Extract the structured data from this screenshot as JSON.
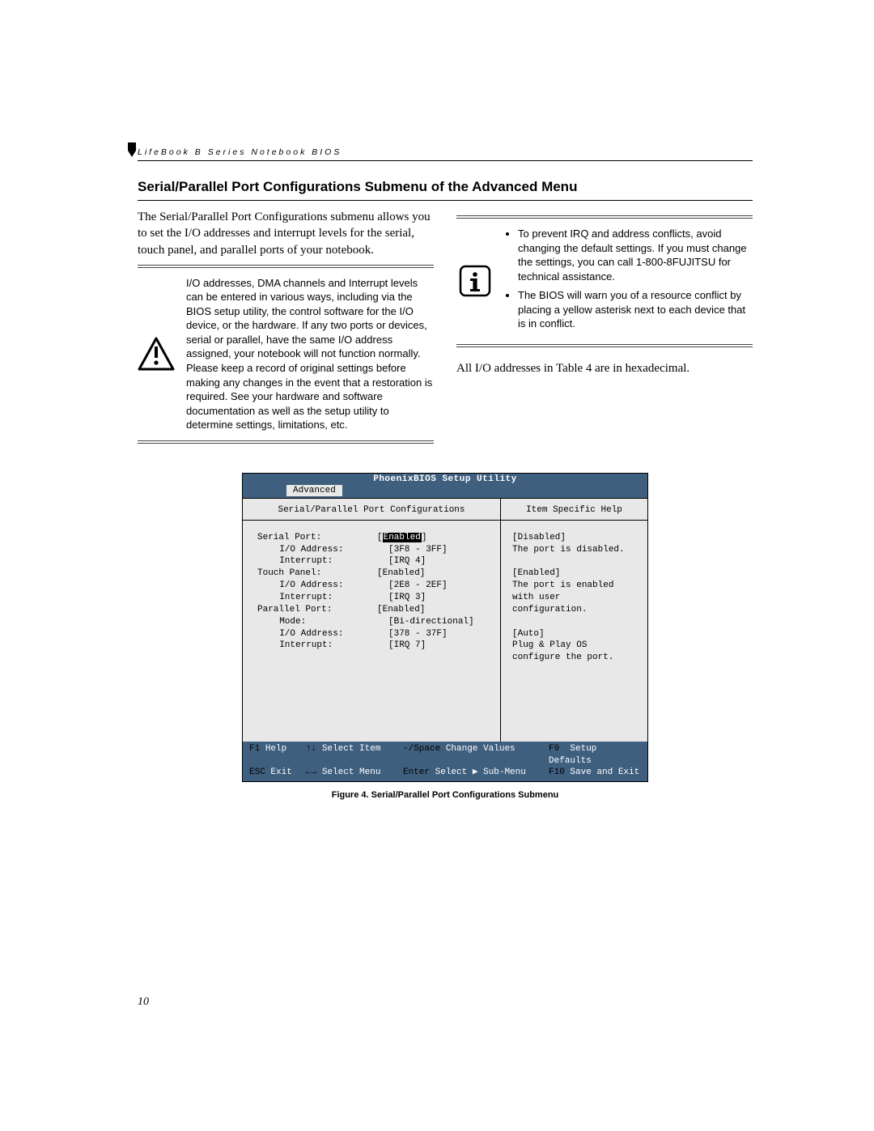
{
  "header": "LifeBook B Series Notebook BIOS",
  "section_title": "Serial/Parallel Port Configurations Submenu of the Advanced Menu",
  "intro": "The Serial/Parallel Port Configurations submenu allows you to set the I/O addresses and interrupt levels for the serial, touch panel, and parallel ports of your notebook.",
  "warning_note": "I/O addresses, DMA channels and Interrupt levels can be entered in various ways, including via the BIOS setup utility, the control software for the I/O device, or the hardware. If any two ports or devices, serial or parallel, have the same I/O address assigned, your notebook will not function normally. Please keep a record of original settings before making any changes in the event that a restoration is required. See your hardware and software documentation as well as the setup utility to determine settings, limitations, etc.",
  "info_bullet_1": "To prevent IRQ and address conflicts, avoid changing the default settings. If you must change the settings, you can call 1-800-8FUJITSU for technical assistance.",
  "info_bullet_2": "The BIOS will warn you of a resource conflict by placing a yellow asterisk next to each device that is in conflict.",
  "post_note": "All I/O addresses in Table 4 are in hexadecimal.",
  "bios": {
    "title": "PhoenixBIOS Setup Utility",
    "menu_tab": "Advanced",
    "left_title": "Serial/Parallel Port Configurations",
    "right_title": "Item Specific Help",
    "rows": [
      {
        "label": "Serial Port:",
        "value": "[Enabled]",
        "selected": true
      },
      {
        "label": "I/O Address:",
        "value": "[3F8 - 3FF]",
        "indent": true
      },
      {
        "label": "Interrupt:",
        "value": "[IRQ 4]",
        "indent": true
      },
      {
        "label": "Touch Panel:",
        "value": "[Enabled]"
      },
      {
        "label": "I/O Address:",
        "value": "[2E8 - 2EF]",
        "indent": true
      },
      {
        "label": "Interrupt:",
        "value": "[IRQ 3]",
        "indent": true
      },
      {
        "label": "Parallel Port:",
        "value": "[Enabled]"
      },
      {
        "label": "Mode:",
        "value": "[Bi-directional]",
        "indent": true
      },
      {
        "label": "I/O Address:",
        "value": "[378 - 37F]",
        "indent": true
      },
      {
        "label": "Interrupt:",
        "value": "[IRQ 7]",
        "indent": true
      }
    ],
    "help_lines": [
      "[Disabled]",
      "The port is disabled.",
      "",
      "[Enabled]",
      "The port is enabled",
      "with user configuration.",
      "",
      "[Auto]",
      "Plug & Play OS",
      "configure the port."
    ],
    "footer": {
      "r1": {
        "k1": "F1",
        "t1": "Help",
        "k2": "↑↓",
        "t2": "Select Item",
        "k3": "-/Space",
        "t3": "Change Values",
        "k4": "F9",
        "t4": "Setup Defaults"
      },
      "r2": {
        "k1": "ESC",
        "t1": "Exit",
        "k2": "←→",
        "t2": "Select Menu",
        "k3": "Enter",
        "t3": "Select ▶ Sub-Menu",
        "k4": "F10",
        "t4": "Save and Exit"
      }
    }
  },
  "caption": "Figure 4.  Serial/Parallel Port Configurations Submenu",
  "page_number": "10"
}
